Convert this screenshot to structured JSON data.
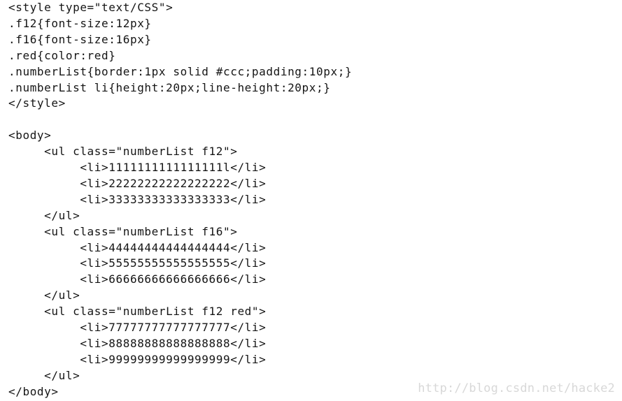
{
  "document": {
    "lines": [
      "<style type=\"text/CSS\">",
      ".f12{font-size:12px}",
      ".f16{font-size:16px}",
      ".red{color:red}",
      ".numberList{border:1px solid #ccc;padding:10px;}",
      ".numberList li{height:20px;line-height:20px;}",
      "</style>",
      "",
      "<body>",
      "     <ul class=\"numberList f12\">",
      "          <li>1111111111111111l</li>",
      "          <li>22222222222222222</li>",
      "          <li>33333333333333333</li>",
      "     </ul>",
      "     <ul class=\"numberList f16\">",
      "          <li>44444444444444444</li>",
      "          <li>55555555555555555</li>",
      "          <li>66666666666666666</li>",
      "     </ul>",
      "     <ul class=\"numberList f12 red\">",
      "          <li>77777777777777777</li>",
      "          <li>88888888888888888</li>",
      "          <li>99999999999999999</li>",
      "     </ul>",
      "</body>"
    ],
    "watermark": "http://blog.csdn.net/hacke2"
  }
}
